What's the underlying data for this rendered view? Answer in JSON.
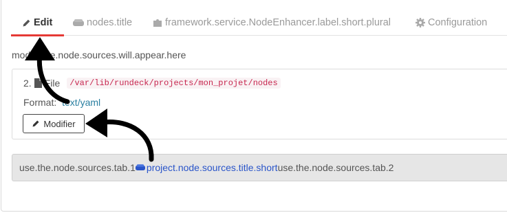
{
  "tabs": [
    {
      "label": "Edit",
      "icon": "pencil-icon",
      "active": true
    },
    {
      "label": "nodes.title",
      "icon": "server-icon",
      "active": false
    },
    {
      "label": "framework.service.NodeEnhancer.label.short.plural",
      "icon": "puzzle-icon",
      "active": false
    },
    {
      "label": "Configuration",
      "icon": "gear-icon",
      "active": false
    }
  ],
  "info_text": "modify.the.node.sources.will.appear.here",
  "source": {
    "index": "2.",
    "title_text": "File",
    "path": "/var/lib/rundeck/projects/mon_projet/nodes",
    "format_label": "Format:",
    "format_value": "text/yaml",
    "modify_label": "Modifier"
  },
  "sub_tabs": {
    "tab1": "use.the.node.sources.tab.1",
    "link": "project.node.sources.title.short",
    "tab2": "use.the.node.sources.tab.2"
  },
  "colors": {
    "active_tab_underline": "#e53935",
    "link": "#2a55c9",
    "path_text": "#c7254e"
  }
}
